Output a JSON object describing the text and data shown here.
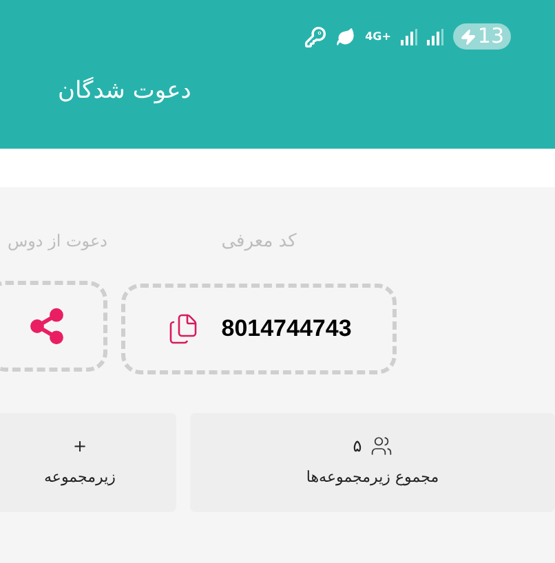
{
  "status_bar": {
    "network": "4G+",
    "battery": "13"
  },
  "header": {
    "title": "دعوت شدگان"
  },
  "referral": {
    "label": "کد معرفی",
    "code": "8014744743"
  },
  "share": {
    "label": "دعوت از دوس"
  },
  "stats": [
    {
      "value": "۵",
      "label": "مجموع زیرمجموعه‌ها"
    },
    {
      "value": "+",
      "label": "زیرمجموعه"
    }
  ]
}
